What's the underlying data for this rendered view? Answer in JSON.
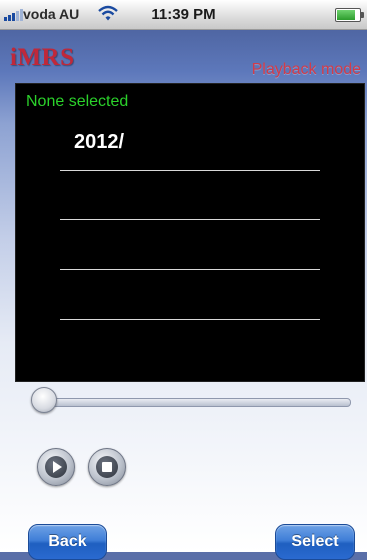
{
  "status_bar": {
    "carrier": "voda AU",
    "time": "11:39 PM",
    "signal_icon": "signal-bars-icon",
    "wifi_icon": "wifi-icon",
    "battery_icon": "battery-icon"
  },
  "app": {
    "logo": "iMRS",
    "mode": "Playback mode"
  },
  "panel": {
    "selection_status": "None selected",
    "items": [
      "2012/",
      "",
      "",
      ""
    ]
  },
  "playback": {
    "progress": 0,
    "play_icon": "play-icon",
    "stop_icon": "stop-icon"
  },
  "footer": {
    "back_label": "Back",
    "select_label": "Select"
  },
  "colors": {
    "logo": "#c0283a",
    "mode": "#d13c4a",
    "selection_status": "#2bd12b",
    "button": "#2a6ad0"
  }
}
